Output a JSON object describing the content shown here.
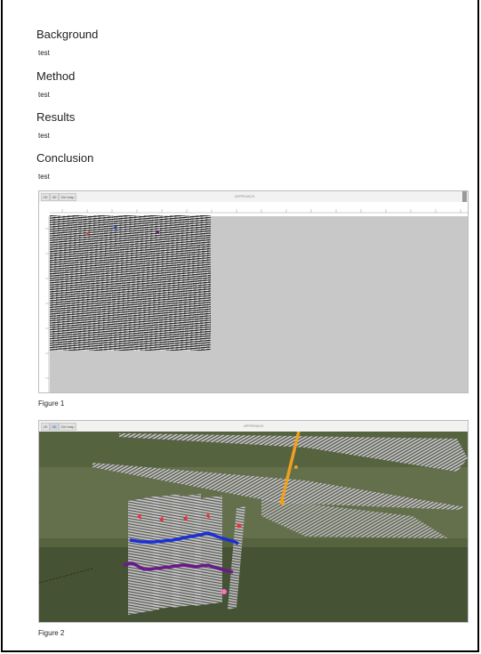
{
  "sections": [
    {
      "heading": "Background",
      "text": "test"
    },
    {
      "heading": "Method",
      "text": "test"
    },
    {
      "heading": "Results",
      "text": "test"
    },
    {
      "heading": "Conclusion",
      "text": "test"
    }
  ],
  "figures": [
    {
      "caption": "Figure 1",
      "toolbar": {
        "btn1": "2D",
        "btn2": "3D",
        "btn3": "Gel map",
        "title": "APPROACH"
      }
    },
    {
      "caption": "Figure 2",
      "toolbar": {
        "btn1": "2D",
        "btn2": "3D",
        "btn3": "Gel map",
        "title": "APPROACH"
      }
    }
  ],
  "colors": {
    "pick_red": "#e8323a",
    "pick_blue": "#1a2fd6",
    "pick_purple": "#6a1a8c",
    "well_orange": "#f0a020",
    "pick_pink": "#ff6ec7"
  }
}
